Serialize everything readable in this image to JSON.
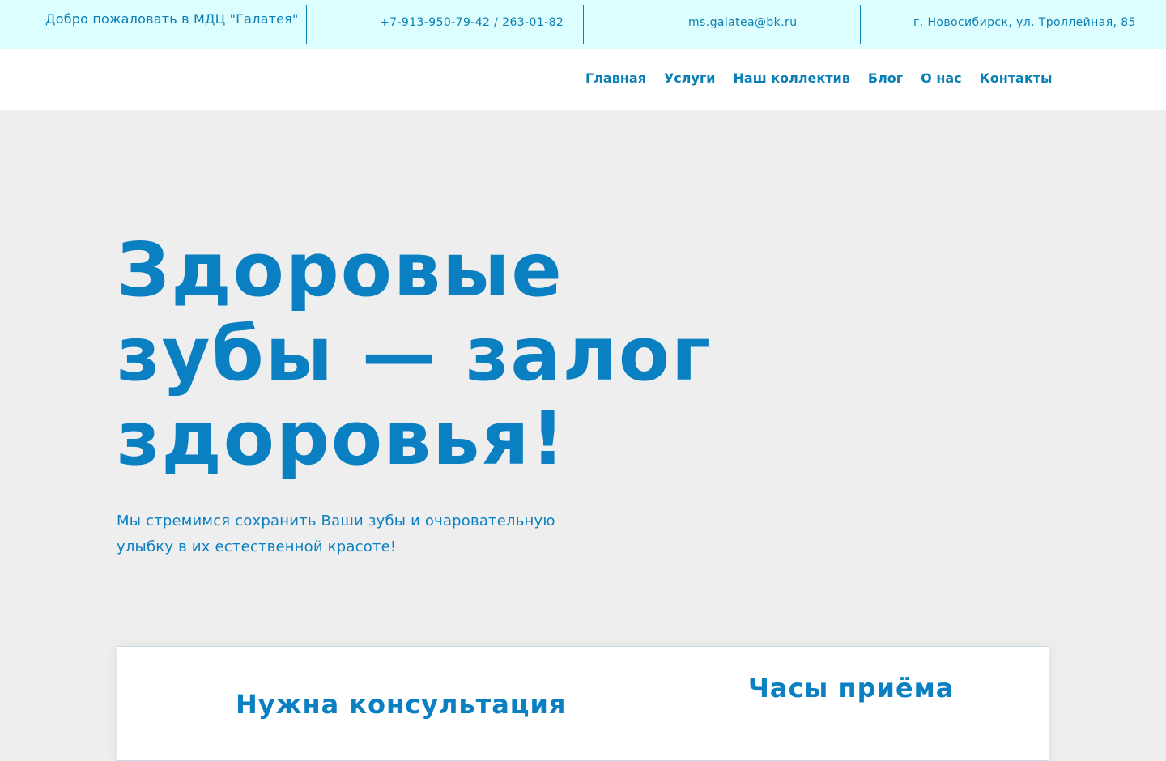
{
  "topbar": {
    "welcome": "Добро пожаловать в МДЦ \"Галатея\"",
    "phone": "+7-913-950-79-42 / 263-01-82",
    "email": "ms.galatea@bk.ru",
    "address": "г. Новосибирск, ул. Троллейная, 85"
  },
  "nav": {
    "items": [
      {
        "label": "Главная"
      },
      {
        "label": "Услуги"
      },
      {
        "label": "Наш коллектив"
      },
      {
        "label": "Блог"
      },
      {
        "label": "О нас"
      },
      {
        "label": "Контакты"
      }
    ]
  },
  "hero": {
    "title": "Здоровые зубы — залог здоровья!",
    "subtitle": "Мы стремимся сохранить Ваши зубы и очаровательную улыбку в их естественной красоте!"
  },
  "card": {
    "consult_title": "Нужна консультация",
    "hours_title": "Часы приёма"
  },
  "colors": {
    "accent": "#0a80c2",
    "topbar_bg": "#dcfefe",
    "page_bg": "#eeeeee"
  }
}
